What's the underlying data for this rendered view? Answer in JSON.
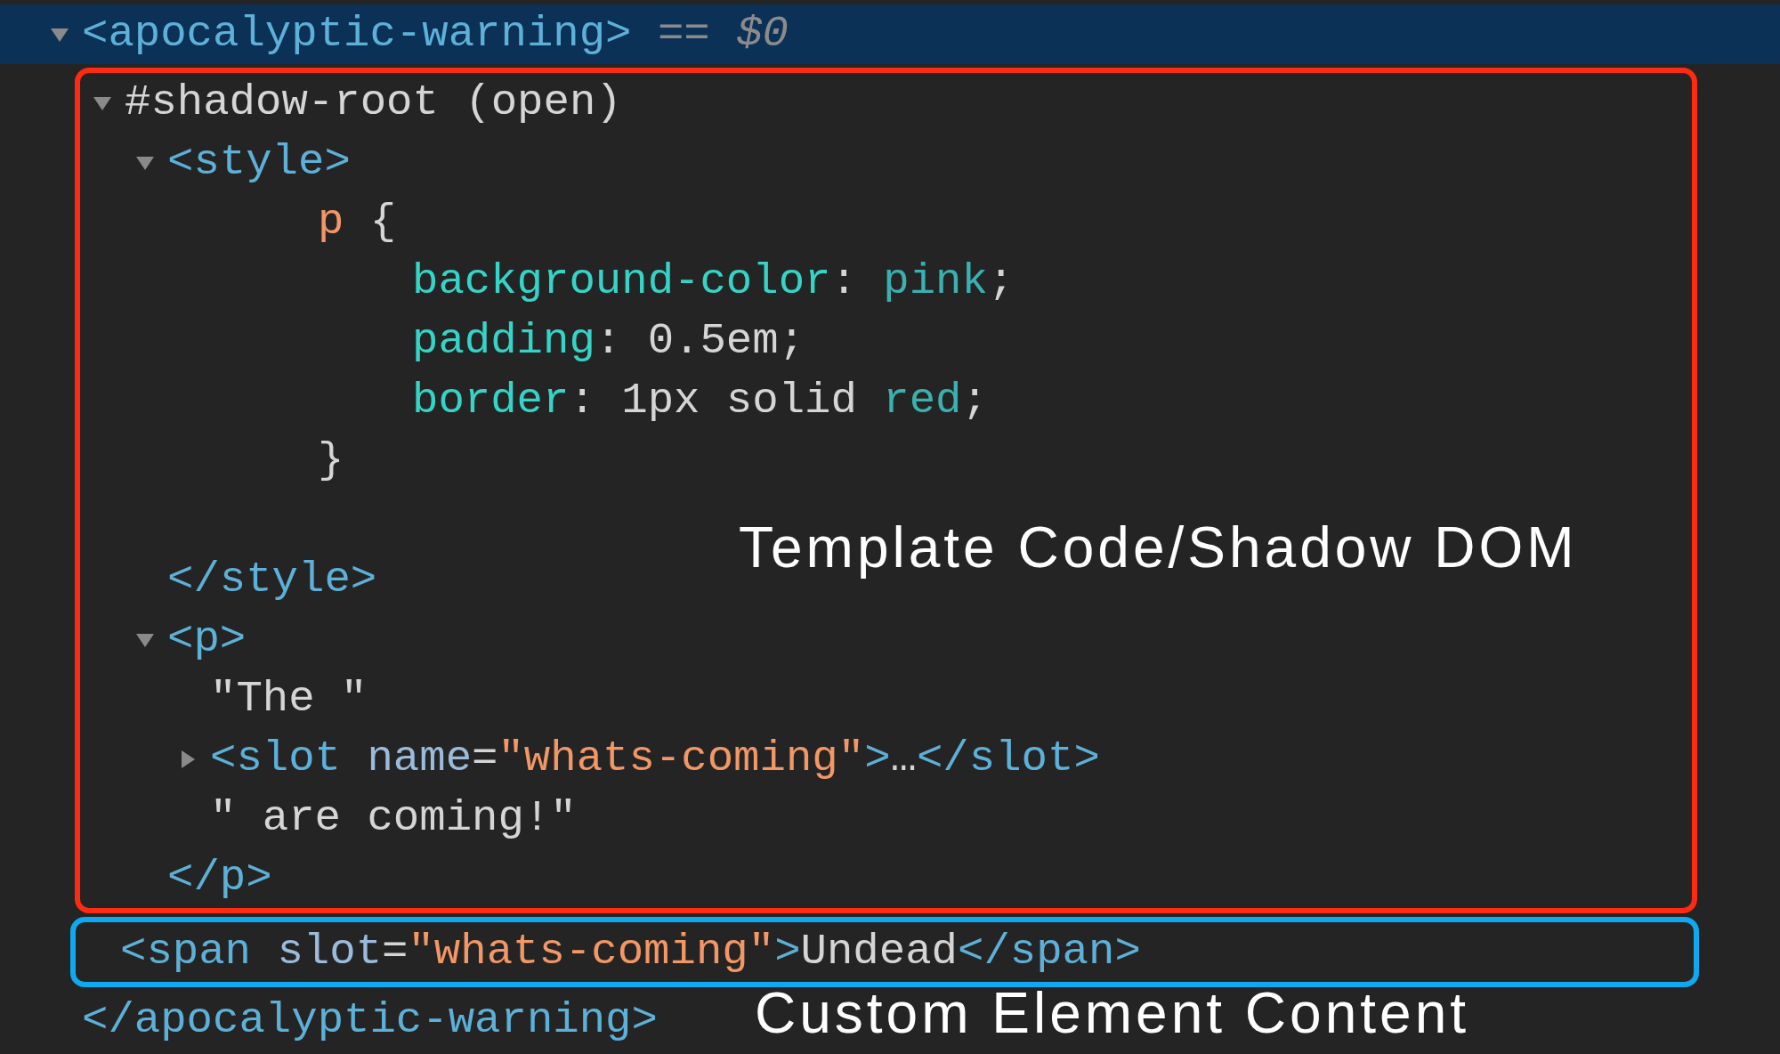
{
  "dom_tree": [
    {
      "selected": true,
      "expanded": true,
      "tokens": [
        {
          "kind": "tag",
          "text": "<apocalyptic-warning>"
        },
        {
          "kind": "marker",
          "text": " == "
        },
        {
          "kind": "variable",
          "text": "$0"
        }
      ],
      "children": [
        {
          "selected": false,
          "expanded": true,
          "annotation": {
            "label": "Template Code/Shadow DOM",
            "color": "#ff2a12"
          },
          "tokens": [
            {
              "kind": "text",
              "text": "#shadow-root (open)"
            }
          ],
          "children": [
            {
              "selected": false,
              "expanded": true,
              "tokens": [
                {
                  "kind": "tag",
                  "text": "<style>"
                }
              ],
              "children": [
                {
                  "kind": "css-rule",
                  "selected": false,
                  "tokens": [
                    {
                      "kind": "selector",
                      "text": "p"
                    },
                    {
                      "kind": "text",
                      "text": " {"
                    }
                  ],
                  "children": [
                    {
                      "kind": "css-declaration",
                      "selected": false,
                      "tokens": [
                        {
                          "kind": "property",
                          "text": "background-color"
                        },
                        {
                          "kind": "text",
                          "text": ": "
                        },
                        {
                          "kind": "keyword",
                          "text": "pink"
                        },
                        {
                          "kind": "text",
                          "text": ";"
                        }
                      ]
                    },
                    {
                      "kind": "css-declaration",
                      "selected": false,
                      "tokens": [
                        {
                          "kind": "property",
                          "text": "padding"
                        },
                        {
                          "kind": "text",
                          "text": ": 0.5em;"
                        }
                      ]
                    },
                    {
                      "kind": "css-declaration",
                      "selected": false,
                      "tokens": [
                        {
                          "kind": "property",
                          "text": "border"
                        },
                        {
                          "kind": "text",
                          "text": ": 1px solid "
                        },
                        {
                          "kind": "keyword",
                          "text": "red"
                        },
                        {
                          "kind": "text",
                          "text": ";"
                        }
                      ]
                    }
                  ]
                },
                {
                  "kind": "css-close",
                  "selected": false,
                  "tokens": [
                    {
                      "kind": "text",
                      "text": "}"
                    }
                  ]
                }
              ]
            },
            {
              "selected": false,
              "tokens": [
                {
                  "kind": "tag",
                  "text": "</style>"
                }
              ]
            },
            {
              "selected": false,
              "expanded": true,
              "tokens": [
                {
                  "kind": "tag",
                  "text": "<p>"
                }
              ],
              "children": [
                {
                  "selected": false,
                  "tokens": [
                    {
                      "kind": "text",
                      "text": "\"The \""
                    }
                  ]
                },
                {
                  "selected": false,
                  "expanded": false,
                  "tokens": [
                    {
                      "kind": "tag",
                      "text": "<slot "
                    },
                    {
                      "kind": "attribute",
                      "text": "name"
                    },
                    {
                      "kind": "text",
                      "text": "="
                    },
                    {
                      "kind": "value",
                      "text": "\"whats-coming\""
                    },
                    {
                      "kind": "tag",
                      "text": ">"
                    },
                    {
                      "kind": "text",
                      "text": "…"
                    },
                    {
                      "kind": "tag",
                      "text": "</slot>"
                    }
                  ]
                },
                {
                  "selected": false,
                  "tokens": [
                    {
                      "kind": "text",
                      "text": "\" are coming!\""
                    }
                  ]
                }
              ]
            },
            {
              "selected": false,
              "tokens": [
                {
                  "kind": "tag",
                  "text": "</p>"
                }
              ]
            }
          ]
        },
        {
          "selected": false,
          "annotation": {
            "label": "Custom Element Content",
            "color": "#10a8f0"
          },
          "tokens": [
            {
              "kind": "tag",
              "text": "<span "
            },
            {
              "kind": "attribute",
              "text": "slot"
            },
            {
              "kind": "text",
              "text": "="
            },
            {
              "kind": "value",
              "text": "\"whats-coming\""
            },
            {
              "kind": "tag",
              "text": ">"
            },
            {
              "kind": "text",
              "text": "Undead"
            },
            {
              "kind": "tag",
              "text": "</span>"
            }
          ]
        }
      ]
    },
    {
      "selected": false,
      "tokens": [
        {
          "kind": "tag",
          "text": "</apocalyptic-warning>"
        }
      ]
    }
  ]
}
